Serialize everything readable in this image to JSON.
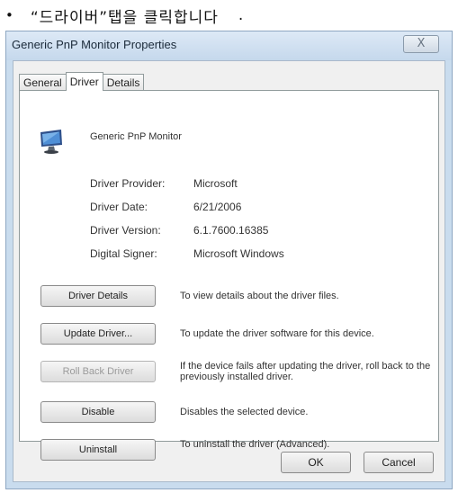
{
  "caption": {
    "bullet": "•",
    "text": "“드라이버”탭을 클릭합니다",
    "trail": "."
  },
  "window": {
    "title": "Generic PnP Monitor Properties",
    "close_label": "X",
    "tabs": [
      {
        "label": "General"
      },
      {
        "label": "Driver"
      },
      {
        "label": "Details"
      }
    ],
    "device_name": "Generic PnP Monitor",
    "info": [
      {
        "label": "Driver Provider:",
        "value": "Microsoft"
      },
      {
        "label": "Driver Date:",
        "value": "6/21/2006"
      },
      {
        "label": "Driver Version:",
        "value": "6.1.7600.16385"
      },
      {
        "label": "Digital Signer:",
        "value": "Microsoft Windows"
      }
    ],
    "actions": [
      {
        "label": "Driver Details",
        "desc": "To view details about the driver files."
      },
      {
        "label": "Update Driver...",
        "desc": "To update the driver software for this device."
      },
      {
        "label": "Roll Back Driver",
        "desc": "If the device fails after updating the driver, roll back to the previously installed driver."
      },
      {
        "label": "Disable",
        "desc": "Disables the selected device."
      },
      {
        "label": "Uninstall",
        "desc": "To uninstall the driver (Advanced)."
      }
    ],
    "ok_label": "OK",
    "cancel_label": "Cancel"
  }
}
